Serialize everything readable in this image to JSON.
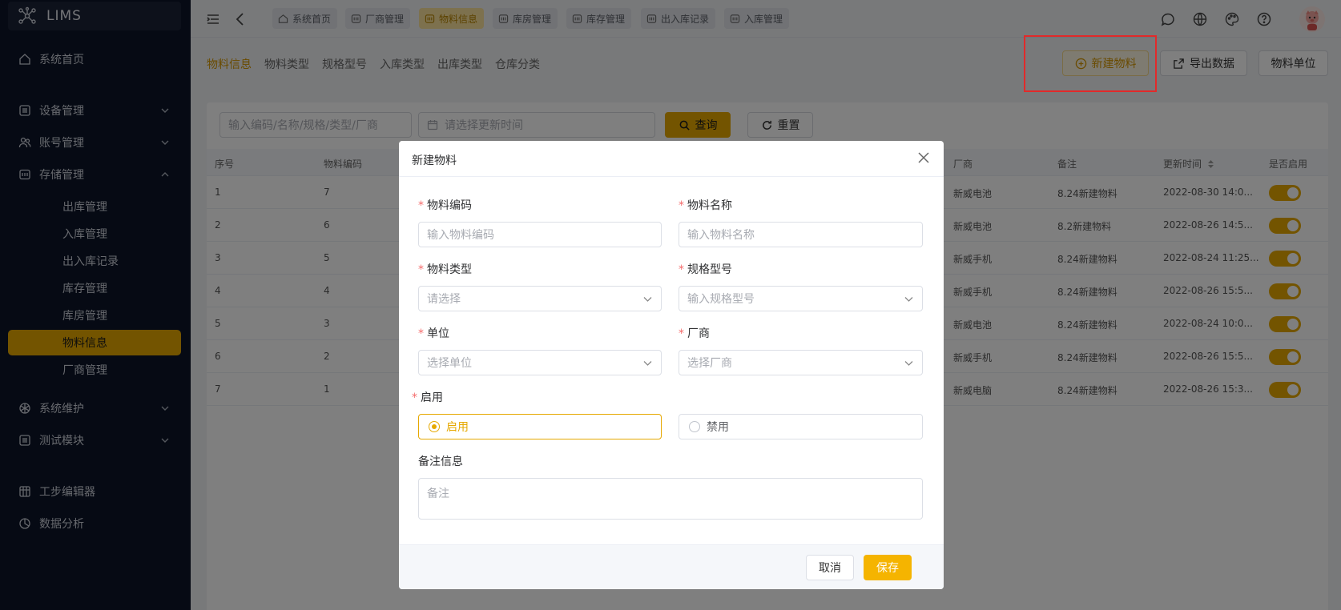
{
  "app": {
    "title": "LIMS"
  },
  "sidebar": {
    "items": [
      {
        "label": "系统首页",
        "icon": "home-icon"
      },
      {
        "label": "设备管理",
        "icon": "device-icon",
        "expandable": true
      },
      {
        "label": "账号管理",
        "icon": "users-icon",
        "expandable": true
      },
      {
        "label": "存储管理",
        "icon": "storage-icon",
        "expandable": true,
        "expanded": true
      },
      {
        "label": "系统维护",
        "icon": "settings-icon",
        "expandable": true
      },
      {
        "label": "测试模块",
        "icon": "test-icon",
        "expandable": true
      },
      {
        "label": "工步编辑器",
        "icon": "grid-icon"
      },
      {
        "label": "数据分析",
        "icon": "chart-icon"
      }
    ],
    "storage_sub": [
      "出库管理",
      "入库管理",
      "出入库记录",
      "库存管理",
      "库房管理",
      "物料信息",
      "厂商管理"
    ],
    "active_sub": "物料信息"
  },
  "topbar": {
    "tags": [
      "系统首页",
      "厂商管理",
      "物料信息",
      "库房管理",
      "库存管理",
      "出入库记录",
      "入库管理"
    ],
    "active_tag": "物料信息"
  },
  "subnav": {
    "links": [
      "物料信息",
      "物料类型",
      "规格型号",
      "入库类型",
      "出库类型",
      "仓库分类"
    ],
    "buttons": {
      "new": "新建物料",
      "export": "导出数据",
      "unit": "物料单位"
    }
  },
  "filter": {
    "search_placeholder": "输入编码/名称/规格/类型/厂商",
    "date_placeholder": "请选择更新时间",
    "query": "查询",
    "reset": "重置"
  },
  "table": {
    "headers": {
      "index": "序号",
      "code": "物料编码",
      "vendor": "厂商",
      "remark": "备注",
      "updated": "更新时间",
      "enabled": "是否启用"
    },
    "rows": [
      {
        "index": "1",
        "code": "7",
        "vendor": "新威电池",
        "remark": "8.24新建物料",
        "updated": "2022-08-30 14:0..."
      },
      {
        "index": "2",
        "code": "6",
        "vendor": "新威电池",
        "remark": "8.2新建物料",
        "updated": "2022-08-26 14:5..."
      },
      {
        "index": "3",
        "code": "5",
        "vendor": "新威手机",
        "remark": "8.24新建物料",
        "updated": "2022-08-24 11:25..."
      },
      {
        "index": "4",
        "code": "4",
        "vendor": "新威手机",
        "remark": "8.24新建物料",
        "updated": "2022-08-26 15:5..."
      },
      {
        "index": "5",
        "code": "3",
        "vendor": "新威电池",
        "remark": "8.24新建物料",
        "updated": "2022-08-24 10:0..."
      },
      {
        "index": "6",
        "code": "2",
        "vendor": "新威手机",
        "remark": "8.24新建物料",
        "updated": "2022-08-26 15:5..."
      },
      {
        "index": "7",
        "code": "1",
        "vendor": "新威电脑",
        "remark": "8.24新建物料",
        "updated": "2022-08-26 15:3..."
      }
    ]
  },
  "modal": {
    "title": "新建物料",
    "fields": {
      "code": {
        "label": "物料编码",
        "placeholder": "输入物料编码"
      },
      "name": {
        "label": "物料名称",
        "placeholder": "输入物料名称"
      },
      "type": {
        "label": "物料类型",
        "placeholder": "请选择"
      },
      "spec": {
        "label": "规格型号",
        "placeholder": "输入规格型号"
      },
      "unit": {
        "label": "单位",
        "placeholder": "选择单位"
      },
      "vendor": {
        "label": "厂商",
        "placeholder": "选择厂商"
      },
      "enable": {
        "label": "启用",
        "on": "启用",
        "off": "禁用"
      },
      "remark": {
        "label": "备注信息",
        "placeholder": "备注"
      }
    },
    "cancel": "取消",
    "save": "保存"
  },
  "colors": {
    "accent": "#e6a800",
    "sidebar_bg": "#0c1428",
    "danger_box": "#e22a2a"
  }
}
